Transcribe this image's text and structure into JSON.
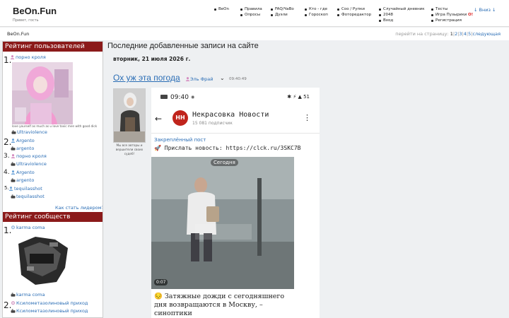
{
  "header": {
    "logo": "BeOn.Fun",
    "greeting": "Привет, гость",
    "menu": [
      [
        "BeOn"
      ],
      [
        "Правила",
        "Опросы"
      ],
      [
        "FAQ/ЧаВо",
        "Дуэли"
      ],
      [
        "Кто - где",
        "Гороскоп"
      ],
      [
        "Соо / Рупки",
        "Фоторедактор"
      ],
      [
        "Случайный дневник",
        "2048",
        "Вход"
      ],
      [
        "Тесты",
        "Игра Пузырики",
        "Регистрация"
      ]
    ],
    "bubbles_mark": "O!",
    "down_link": "↓ Вниз ↓"
  },
  "subbar": {
    "site": "BeOn.Fun",
    "pager_label": "перейти на страницу:",
    "pages": [
      "1",
      "2",
      "3",
      "4",
      "5"
    ],
    "next": "следующая"
  },
  "sidebar": {
    "users_title": "Рейтинг пользователей",
    "users": [
      {
        "rank": "1.",
        "name": "порно кроля",
        "caption": "love yourself as much as u love toxic men with good dick",
        "partner": "Ultraviolence"
      },
      {
        "rank": "2.",
        "name": "Argento",
        "partner": "argento"
      },
      {
        "rank": "3.",
        "name": "порно кроля",
        "partner": "Ultraviolence"
      },
      {
        "rank": "4.",
        "name": "Argento",
        "partner": "argento"
      },
      {
        "rank": "5.",
        "name": "tequilasshot",
        "partner": "tequilasshot"
      }
    ],
    "leader_link": "Как стать лидером?",
    "communities_title": "Рейтинг сообществ",
    "communities": [
      {
        "rank": "1.",
        "name": "karma coma",
        "partner": "karma coma"
      },
      {
        "rank": "2.",
        "name": "Ксилометазолиновый приход",
        "partner": "Ксилометазолиновый приход"
      }
    ]
  },
  "main": {
    "title": "Последние добавленные записи на сайте",
    "date": "вторник, 21 июля 2026 г.",
    "post": {
      "title": "Ох уж эта погода",
      "author": "Эль Фрай",
      "time": "09:40:49",
      "author_caption": "Мы все авторы и вершители своих судеб!",
      "screenshot": {
        "status_time": "09:40",
        "status_icons": "✱ ⚡ ▲ 51",
        "channel_logo": "НН",
        "channel": "Некрасовка Новости",
        "subscribers": "15 081 подписчик",
        "pinned_label": "Закреплённый пост",
        "pinned_text": "Прислать новость: https://clck.ru/3SKC7B",
        "video_badge": "Сегодня",
        "video_duration": "0:07",
        "text": "Затяжные дожди с сегодняшнего дня возвращаются в Москву, – синоптики"
      }
    }
  },
  "colors": {
    "accent_link": "#2a6db5",
    "sidebar_header": "#8b1a1a",
    "channel_red": "#c0241c"
  }
}
